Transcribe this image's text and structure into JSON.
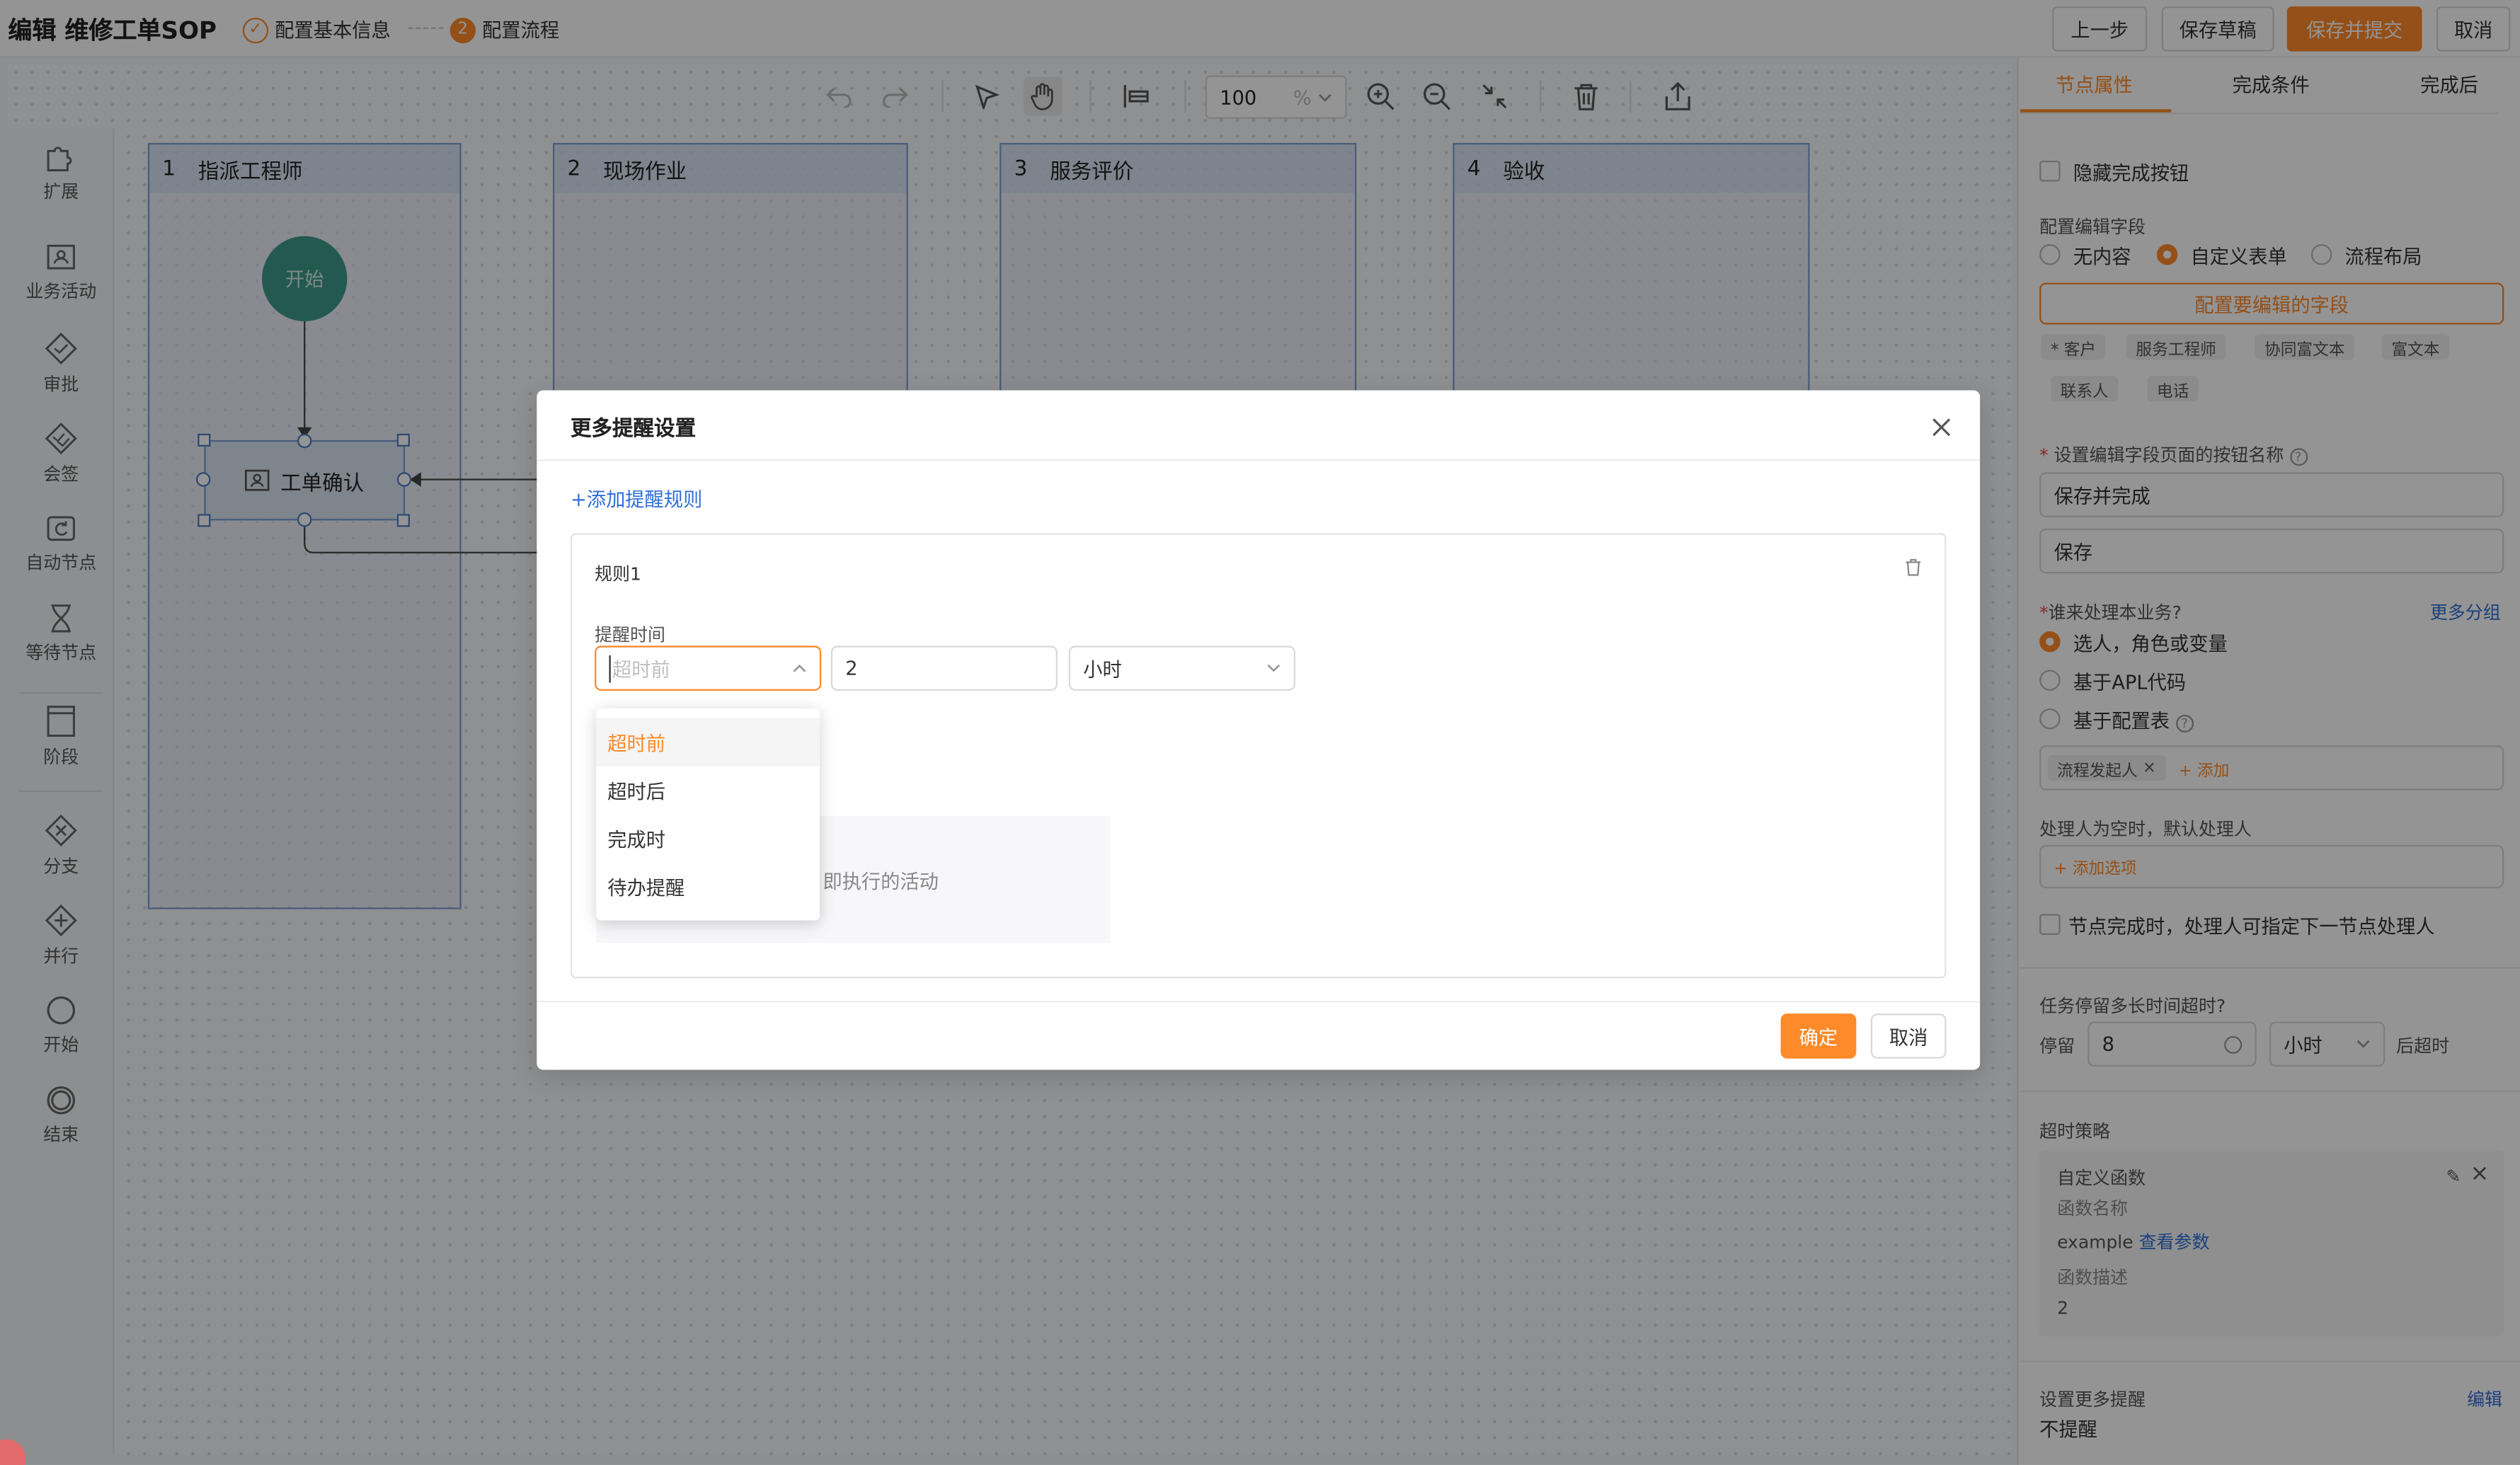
{
  "header": {
    "title": "编辑 维修工单SOP",
    "steps": [
      {
        "num": "✓",
        "label": "配置基本信息"
      },
      {
        "num": "2",
        "label": "配置流程"
      }
    ],
    "buttons": {
      "prev": "上一步",
      "save_draft": "保存草稿",
      "save_submit": "保存并提交",
      "cancel": "取消"
    }
  },
  "toolbar": {
    "zoom_value": "100",
    "zoom_unit": "%"
  },
  "palette": [
    {
      "label": "扩展",
      "icon": "puzzle-icon"
    },
    {
      "label": "业务活动",
      "icon": "user-card-icon"
    },
    {
      "label": "审批",
      "icon": "approve-diamond-icon"
    },
    {
      "label": "会签",
      "icon": "countersign-icon"
    },
    {
      "label": "自动节点",
      "icon": "auto-node-icon"
    },
    {
      "label": "等待节点",
      "icon": "hourglass-icon"
    },
    {
      "label": "阶段",
      "icon": "stage-icon"
    },
    {
      "label": "分支",
      "icon": "branch-icon"
    },
    {
      "label": "并行",
      "icon": "parallel-icon"
    },
    {
      "label": "开始",
      "icon": "start-circle-icon"
    },
    {
      "label": "结束",
      "icon": "end-circle-icon"
    }
  ],
  "lanes": [
    {
      "num": "1",
      "name": "指派工程师"
    },
    {
      "num": "2",
      "name": "现场作业"
    },
    {
      "num": "3",
      "name": "服务评价"
    },
    {
      "num": "4",
      "name": "验收"
    }
  ],
  "nodes": {
    "start": "开始",
    "task": "工单确认"
  },
  "panel": {
    "tabs": [
      "节点属性",
      "完成条件",
      "完成后"
    ],
    "hide_complete_btn": "隐藏完成按钮",
    "edit_field_label": "配置编辑字段",
    "edit_field_options": [
      "无内容",
      "自定义表单",
      "流程布局"
    ],
    "configure_fields_btn": "配置要编辑的字段",
    "field_chips": [
      "* 客户",
      "服务工程师",
      "协同富文本",
      "富文本",
      "联系人",
      "电话"
    ],
    "button_name_label": "设置编辑字段页面的按钮名称",
    "button_name_values": [
      "保存并完成",
      "保存"
    ],
    "who_label": "谁来处理本业务?",
    "more_groups": "更多分组",
    "who_options": [
      "选人，角色或变量",
      "基于APL代码",
      "基于配置表"
    ],
    "assignee_chip": "流程发起人",
    "assignee_add": "+ 添加",
    "empty_default_label": "处理人为空时，默认处理人",
    "add_option": "+ 添加选项",
    "next_assignee": "节点完成时，处理人可指定下一节点处理人",
    "timeout_q": "任务停留多长时间超时?",
    "stay_label": "停留",
    "stay_value": "8",
    "stay_unit": "小时",
    "timeout_suffix": "后超时",
    "strategy_label": "超时策略",
    "func_title": "自定义函数",
    "func_name_label": "函数名称",
    "func_name": "example",
    "view_params": "查看参数",
    "func_desc_label": "函数描述",
    "func_desc": "2",
    "more_reminder_label": "设置更多提醒",
    "edit": "编辑",
    "no_reminder": "不提醒"
  },
  "dialog": {
    "title": "更多提醒设置",
    "add_rule": "+添加提醒规则",
    "rule_title": "规则1",
    "remind_time_label": "提醒时间",
    "when_placeholder": "超时前",
    "amount": "2",
    "unit": "小时",
    "options": [
      "超时前",
      "超时后",
      "完成时",
      "待办提醒"
    ],
    "hidden_text": "即执行的活动",
    "ok": "确定",
    "cancel": "取消"
  }
}
